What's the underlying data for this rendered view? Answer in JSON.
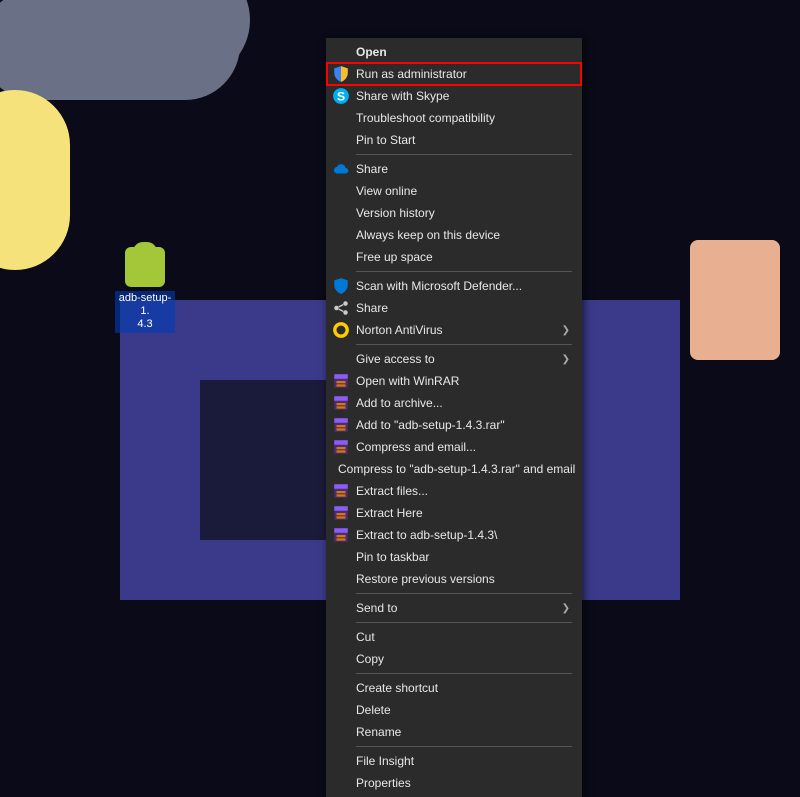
{
  "desktop": {
    "icon_label_1": "adb-setup-1.",
    "icon_label_2": "4.3"
  },
  "menu": {
    "groups": [
      [
        {
          "icon": "",
          "label": "Open",
          "bold": true,
          "arrow": false,
          "name": "open"
        },
        {
          "icon": "shield",
          "label": "Run as administrator",
          "bold": false,
          "arrow": false,
          "name": "run-as-administrator"
        },
        {
          "icon": "skype",
          "label": "Share with Skype",
          "bold": false,
          "arrow": false,
          "name": "share-with-skype"
        },
        {
          "icon": "",
          "label": "Troubleshoot compatibility",
          "bold": false,
          "arrow": false,
          "name": "troubleshoot-compatibility"
        },
        {
          "icon": "",
          "label": "Pin to Start",
          "bold": false,
          "arrow": false,
          "name": "pin-to-start"
        }
      ],
      [
        {
          "icon": "cloud",
          "label": "Share",
          "bold": false,
          "arrow": false,
          "name": "onedrive-share"
        },
        {
          "icon": "",
          "label": "View online",
          "bold": false,
          "arrow": false,
          "name": "view-online"
        },
        {
          "icon": "",
          "label": "Version history",
          "bold": false,
          "arrow": false,
          "name": "version-history"
        },
        {
          "icon": "",
          "label": "Always keep on this device",
          "bold": false,
          "arrow": false,
          "name": "always-keep"
        },
        {
          "icon": "",
          "label": "Free up space",
          "bold": false,
          "arrow": false,
          "name": "free-up-space"
        }
      ],
      [
        {
          "icon": "def",
          "label": "Scan with Microsoft Defender...",
          "bold": false,
          "arrow": false,
          "name": "scan-defender"
        },
        {
          "icon": "share",
          "label": "Share",
          "bold": false,
          "arrow": false,
          "name": "share"
        },
        {
          "icon": "norton",
          "label": "Norton AntiVirus",
          "bold": false,
          "arrow": true,
          "name": "norton-antivirus"
        }
      ],
      [
        {
          "icon": "",
          "label": "Give access to",
          "bold": false,
          "arrow": true,
          "name": "give-access-to"
        },
        {
          "icon": "winrar",
          "label": "Open with WinRAR",
          "bold": false,
          "arrow": false,
          "name": "open-winrar"
        },
        {
          "icon": "winrar",
          "label": "Add to archive...",
          "bold": false,
          "arrow": false,
          "name": "add-to-archive"
        },
        {
          "icon": "winrar",
          "label": "Add to \"adb-setup-1.4.3.rar\"",
          "bold": false,
          "arrow": false,
          "name": "add-to-named-rar"
        },
        {
          "icon": "winrar",
          "label": "Compress and email...",
          "bold": false,
          "arrow": false,
          "name": "compress-email"
        },
        {
          "icon": "winrar",
          "label": "Compress to \"adb-setup-1.4.3.rar\" and email",
          "bold": false,
          "arrow": false,
          "name": "compress-named-email"
        },
        {
          "icon": "winrar",
          "label": "Extract files...",
          "bold": false,
          "arrow": false,
          "name": "extract-files"
        },
        {
          "icon": "winrar",
          "label": "Extract Here",
          "bold": false,
          "arrow": false,
          "name": "extract-here"
        },
        {
          "icon": "winrar",
          "label": "Extract to adb-setup-1.4.3\\",
          "bold": false,
          "arrow": false,
          "name": "extract-to-folder"
        },
        {
          "icon": "",
          "label": "Pin to taskbar",
          "bold": false,
          "arrow": false,
          "name": "pin-to-taskbar"
        },
        {
          "icon": "",
          "label": "Restore previous versions",
          "bold": false,
          "arrow": false,
          "name": "restore-previous"
        }
      ],
      [
        {
          "icon": "",
          "label": "Send to",
          "bold": false,
          "arrow": true,
          "name": "send-to"
        }
      ],
      [
        {
          "icon": "",
          "label": "Cut",
          "bold": false,
          "arrow": false,
          "name": "cut"
        },
        {
          "icon": "",
          "label": "Copy",
          "bold": false,
          "arrow": false,
          "name": "copy"
        }
      ],
      [
        {
          "icon": "",
          "label": "Create shortcut",
          "bold": false,
          "arrow": false,
          "name": "create-shortcut"
        },
        {
          "icon": "",
          "label": "Delete",
          "bold": false,
          "arrow": false,
          "name": "delete"
        },
        {
          "icon": "",
          "label": "Rename",
          "bold": false,
          "arrow": false,
          "name": "rename"
        }
      ],
      [
        {
          "icon": "",
          "label": "File Insight",
          "bold": false,
          "arrow": false,
          "name": "file-insight"
        },
        {
          "icon": "",
          "label": "Properties",
          "bold": false,
          "arrow": false,
          "name": "properties"
        }
      ]
    ]
  }
}
